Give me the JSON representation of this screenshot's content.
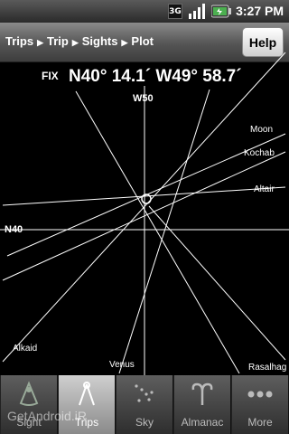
{
  "statusbar": {
    "network": "3G",
    "time": "3:27 PM"
  },
  "nav": {
    "breadcrumb": [
      "Trips",
      "Trip",
      "Sights",
      "Plot"
    ],
    "help": "Help"
  },
  "fix": {
    "label": "FIX",
    "value": "N40° 14.1´ W49° 58.7´"
  },
  "plot": {
    "grid": {
      "longitude": "W50",
      "latitude": "N40"
    },
    "bodies": [
      "Moon",
      "Kochab",
      "Altair",
      "Alkaid",
      "Venus",
      "Rasalhag"
    ]
  },
  "tabs": [
    {
      "label": "Sight",
      "icon": "sextant-icon"
    },
    {
      "label": "Trips",
      "icon": "compass-icon"
    },
    {
      "label": "Sky",
      "icon": "stars-icon"
    },
    {
      "label": "Almanac",
      "icon": "aries-icon"
    },
    {
      "label": "More",
      "icon": "more-icon"
    }
  ],
  "watermark": "GetAndroid.iR"
}
